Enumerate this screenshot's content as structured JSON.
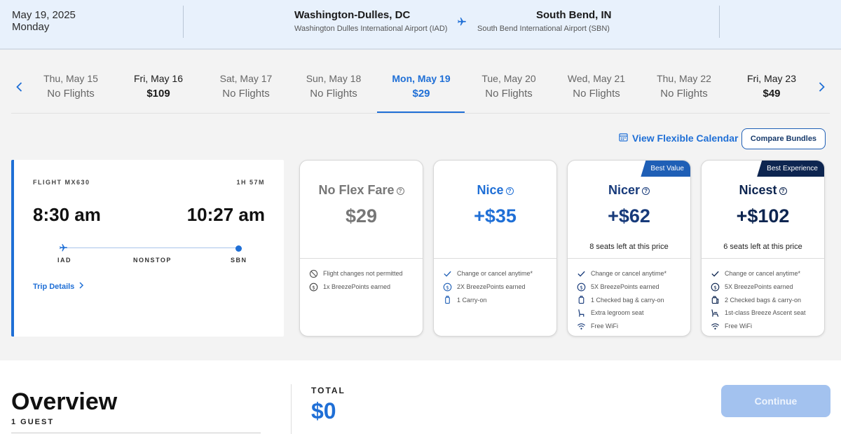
{
  "header": {
    "date": "May 19, 2025",
    "weekday": "Monday",
    "origin_city": "Washington-Dulles, DC",
    "origin_airport": "Washington Dulles International Airport (IAD)",
    "dest_city": "South Bend, IN",
    "dest_airport": "South Bend International Airport (SBN)"
  },
  "dates": [
    {
      "day": "Thu, May 15",
      "price": "No Flights"
    },
    {
      "day": "Fri, May 16",
      "price": "$109"
    },
    {
      "day": "Sat, May 17",
      "price": "No Flights"
    },
    {
      "day": "Sun, May 18",
      "price": "No Flights"
    },
    {
      "day": "Mon, May 19",
      "price": "$29"
    },
    {
      "day": "Tue, May 20",
      "price": "No Flights"
    },
    {
      "day": "Wed, May 21",
      "price": "No Flights"
    },
    {
      "day": "Thu, May 22",
      "price": "No Flights"
    },
    {
      "day": "Fri, May 23",
      "price": "$49"
    }
  ],
  "actions": {
    "flex_calendar": "View Flexible Calendar",
    "compare_bundles": "Compare Bundles"
  },
  "flight": {
    "number": "FLIGHT MX630",
    "duration": "1H 57M",
    "depart": "8:30 am",
    "arrive": "10:27 am",
    "origin": "IAD",
    "stops": "NONSTOP",
    "dest": "SBN",
    "details": "Trip Details"
  },
  "fares": [
    {
      "name": "No Flex Fare",
      "price": "$29",
      "seats": "",
      "badge": "",
      "color": "#777777",
      "features": [
        {
          "icon": "no-icon",
          "text": "Flight changes not permitted"
        },
        {
          "icon": "points-icon",
          "text": "1x BreezePoints earned"
        }
      ]
    },
    {
      "name": "Nice",
      "price": "+$35",
      "seats": "",
      "badge": "",
      "color": "#1f6fd6",
      "features": [
        {
          "icon": "check-icon",
          "text": "Change or cancel anytime*"
        },
        {
          "icon": "points-icon",
          "text": "2X BreezePoints earned"
        },
        {
          "icon": "carry-on-icon",
          "text": "1 Carry-on"
        }
      ]
    },
    {
      "name": "Nicer",
      "price": "+$62",
      "seats": "8 seats left at this price",
      "badge": "Best Value",
      "color": "#173a7a",
      "features": [
        {
          "icon": "check-icon",
          "text": "Change or cancel anytime*"
        },
        {
          "icon": "points-icon",
          "text": "5X BreezePoints earned"
        },
        {
          "icon": "bag-icon",
          "text": "1 Checked bag & carry-on"
        },
        {
          "icon": "seat-icon",
          "text": "Extra legroom seat"
        },
        {
          "icon": "wifi-icon",
          "text": "Free WiFi"
        }
      ]
    },
    {
      "name": "Nicest",
      "price": "+$102",
      "seats": "6 seats left at this price",
      "badge": "Best Experience",
      "color": "#0d2550",
      "features": [
        {
          "icon": "check-icon",
          "text": "Change or cancel anytime*"
        },
        {
          "icon": "points-icon",
          "text": "5X BreezePoints earned"
        },
        {
          "icon": "bags-icon",
          "text": "2 Checked bags & carry-on"
        },
        {
          "icon": "recliner-icon",
          "text": "1st-class Breeze Ascent seat"
        },
        {
          "icon": "wifi-icon",
          "text": "Free WiFi"
        }
      ]
    }
  ],
  "overview": {
    "title": "Overview",
    "guests": "1 GUEST",
    "total_label": "TOTAL",
    "total": "$0",
    "continue": "Continue"
  }
}
